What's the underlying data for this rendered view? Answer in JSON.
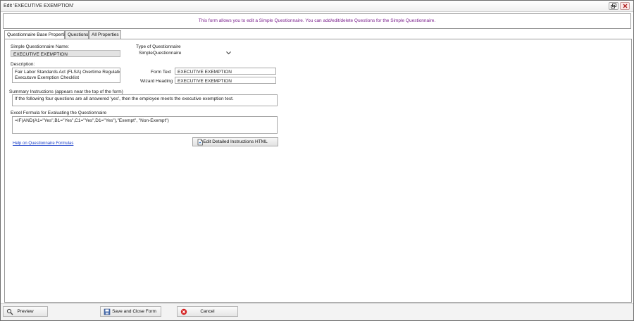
{
  "window": {
    "title": "Edit 'EXECUTIVE EXEMPTION'"
  },
  "banner": {
    "text": "This form allows you to edit a Simple Questionnaire. You can add/edit/delete Questions for the Simple Questionnaire."
  },
  "tabs": [
    {
      "label": "Questionnaire Base Properties",
      "active": true
    },
    {
      "label": "Questions",
      "active": false
    },
    {
      "label": "All Properties",
      "active": false
    }
  ],
  "form": {
    "name_label": "Simple Questionnaire Name:",
    "name_value": "EXECUTIVE EXEMPTION",
    "type_label": "Type of Questionnaire",
    "type_value": "SimpleQuestionnaire",
    "description_label": "Description:",
    "description_value": "Fair Labor Standards Act (FLSA) Overtime Regulations\nExecutuve Exemption Checklist",
    "form_text_label": "Form Text",
    "form_text_value": "EXECUTIVE EXEMPTION",
    "wizard_heading_label": "Wizard Heading",
    "wizard_heading_value": "EXECUTIVE EXEMPTION",
    "summary_label": "Summary Instructions (appears near the top of the form)",
    "summary_value": "If the following four questions are all answered 'yes', then the employee meets the executive exemption test.",
    "formula_label": "Excel Formula for Evaluating the Questionnaire",
    "formula_value": "=IF(AND(A1=\"Yes\",B1=\"Yes\",C1=\"Yes\",D1=\"Yes\"),\"Exempt\", \"Non-Exempt\")",
    "help_link": "Help on Questionnaire Formulas",
    "edit_html_button": "Edit Detailed Instructions HTML"
  },
  "bottom": {
    "preview": "Preview",
    "save_close": "Save and Close Form",
    "cancel": "Cancel"
  },
  "colors": {
    "banner_text": "#7a1f8c",
    "link": "#1a3fc9",
    "cancel_icon": "#d42020"
  },
  "icons": {
    "preview": "preview-icon",
    "save": "save-icon",
    "cancel": "cancel-icon",
    "html": "html-document-icon",
    "dropdown": "chevron-down-icon"
  }
}
